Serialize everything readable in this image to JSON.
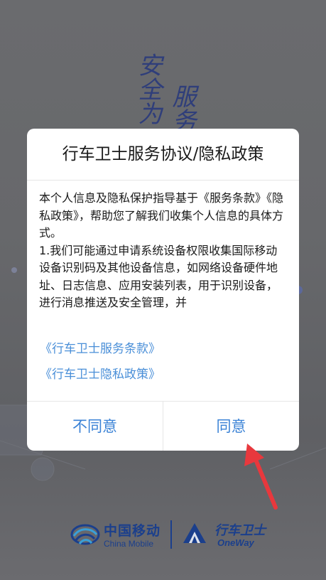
{
  "splash": {
    "slogan_col1": "安全为",
    "slogan_col2": "服务"
  },
  "dialog": {
    "title": "行车卫士服务协议/隐私政策",
    "body_paragraphs": [
      "本个人信息及隐私保护指导基于《服务条款》《隐私政策》，帮助您了解我们收集个人信息的具体方式。",
      "1.我们可能通过申请系统设备权限收集国际移动设备识别码及其他设备信息，如网络设备硬件地址、日志信息、应用安装列表，用于识别设备，进行消息推送及安全管理，并"
    ],
    "links": {
      "service_terms": "《行车卫士服务条款》",
      "privacy_policy": "《行车卫士隐私政策》"
    },
    "buttons": {
      "disagree": "不同意",
      "agree": "同意"
    }
  },
  "brand": {
    "china_mobile_cn": "中国移动",
    "china_mobile_en": "China Mobile",
    "oneway_cn": "行车卫士",
    "oneway_en": "OneWay"
  },
  "colors": {
    "link": "#4a8fd8",
    "button_text": "#3a82d6",
    "brand_blue": "#1b3f8c",
    "annotation_red": "#e8383d"
  },
  "icons": {
    "china_mobile_logo": "china-mobile-logo-icon",
    "oneway_logo": "oneway-logo-icon",
    "annotation": "red-arrow-icon"
  }
}
